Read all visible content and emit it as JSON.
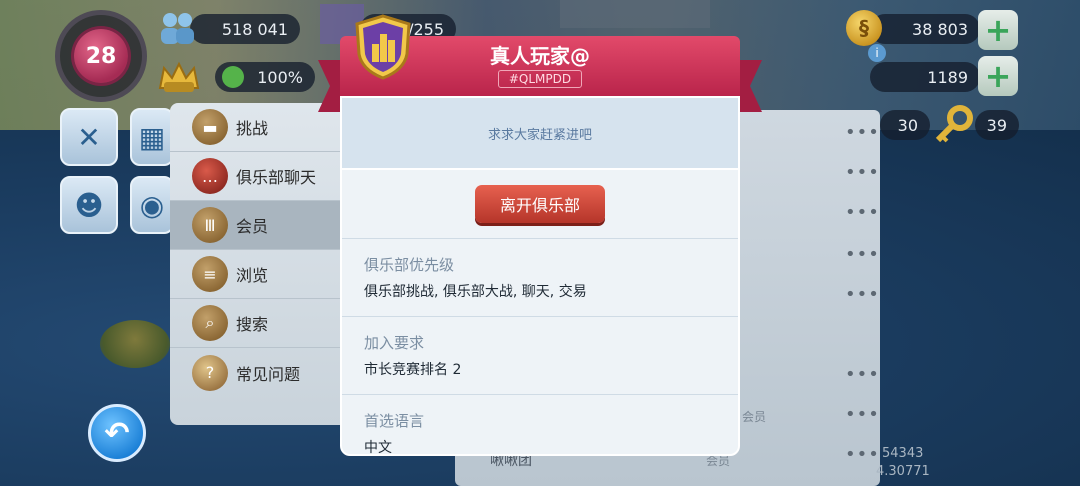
{
  "hud": {
    "level": "28",
    "population": "518 041",
    "storage": "/255",
    "happiness": "100%",
    "simcash": "38 803",
    "gold_count": "1189",
    "counter_a": "30",
    "keys": "39",
    "faint_a": "54343",
    "faint_b": "4.30771"
  },
  "side_menu": {
    "items": [
      {
        "label": "挑战",
        "icon": "chest-icon"
      },
      {
        "label": "俱乐部聊天",
        "icon": "chat-icon"
      },
      {
        "label": "会员",
        "icon": "members-icon"
      },
      {
        "label": "浏览",
        "icon": "browse-icon"
      },
      {
        "label": "搜索",
        "icon": "search-icon"
      },
      {
        "label": "常见问题",
        "icon": "faq-book-icon"
      }
    ]
  },
  "club": {
    "name": "真人玩家@",
    "tag": "#QLMPDD",
    "motto": "求求大家赶紧进吧",
    "leave_label": "离开俱乐部",
    "sections": [
      {
        "label": "俱乐部优先级",
        "value": "俱乐部挑战, 俱乐部大战, 聊天, 交易"
      },
      {
        "label": "加入要求",
        "value": "市长竞赛排名 2"
      },
      {
        "label": "首选语言",
        "value": "中文"
      }
    ]
  },
  "background_list": {
    "member_fragment": "会员",
    "row_name_fragment": "啾啾团",
    "row_rank_fragment": "会员"
  },
  "colors": {
    "ribbon": "#c8284f",
    "leave_button": "#c9453a",
    "accent_blue": "#1a7fd6"
  }
}
